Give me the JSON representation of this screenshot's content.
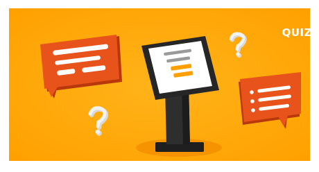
{
  "banner": {
    "label": "QUIZ",
    "colors": {
      "background": "#FFA90E",
      "bubble": "#E8531B",
      "bubble_shade": "#B8380C",
      "kiosk": "#2A2A2A",
      "screen": "#FFFFFF",
      "screen_line": "#9A9A9A",
      "screen_highlight": "#FFA000",
      "question_mark": "#E6E6E6"
    },
    "icons": [
      "speech-bubble-icon",
      "kiosk-icon",
      "question-mark-icon",
      "list-bubble-icon"
    ]
  }
}
